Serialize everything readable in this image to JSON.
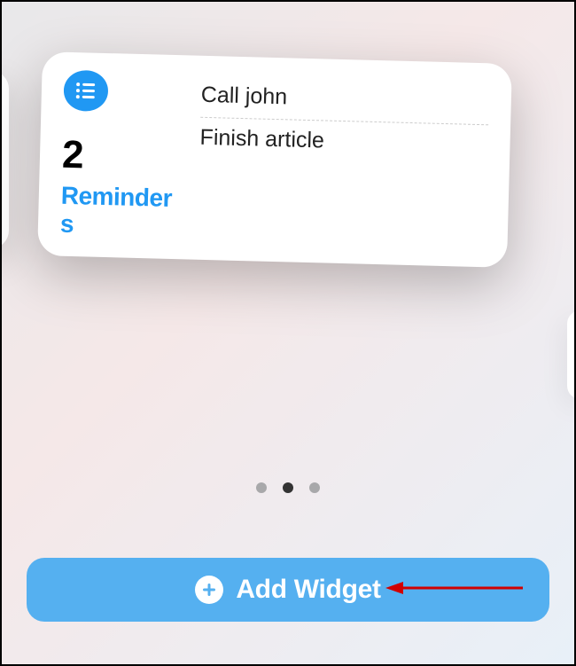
{
  "widget": {
    "count": "2",
    "label": "Reminders",
    "items": [
      "Call john",
      "Finish article"
    ]
  },
  "pagination": {
    "total": 3,
    "active_index": 1
  },
  "button": {
    "label": "Add Widget"
  },
  "colors": {
    "accent": "#2098f3",
    "button_bg": "#55b0f0"
  }
}
